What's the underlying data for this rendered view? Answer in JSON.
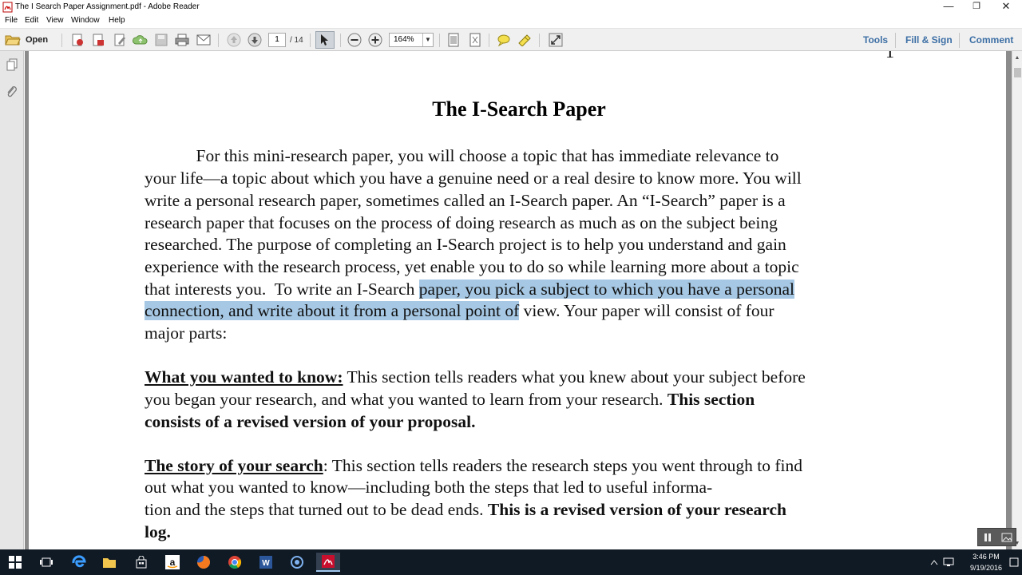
{
  "window": {
    "title": "The I Search Paper Assignment.pdf - Adobe Reader",
    "minimize": "—",
    "restore": "❐",
    "close": "✕"
  },
  "menu": [
    "File",
    "Edit",
    "View",
    "Window",
    "Help"
  ],
  "toolbar": {
    "open_label": "Open",
    "page_current": "1",
    "page_total": "/ 14",
    "zoom": "164%",
    "tools": "Tools",
    "fill_sign": "Fill & Sign",
    "comment": "Comment"
  },
  "document": {
    "page_number": "1",
    "title": "The I-Search Paper",
    "lines": [
      "            For this mini-research paper, you will choose a topic that has immediate relevance to",
      "your life—a topic about which you have a genuine need or a real desire to know more. You will",
      "write a personal research paper, sometimes called an I-Search paper. An “I-Search” paper is a",
      "research paper that focuses on the process of doing research as much as on the subject being",
      "researched. The purpose of completing an I-Search project is to help you understand and gain",
      "experience with the research process, yet enable you to do so while learning more about a topic"
    ],
    "line7_pre": "that interests you.  To write an I-Search ",
    "line7_hl": "paper, you pick a subject to which you have a personal",
    "line8_hl": "connection, and write about it from a personal point of",
    "line8_post": " view. Your paper will consist of four",
    "line9": "major parts:",
    "s1_heading": "What you wanted to know:",
    "s1_l1": " This section tells readers what you knew about your subject before",
    "s1_l2_pre": "you began your research, and what you wanted to learn from your research. ",
    "s1_l2_bold": "This section",
    "s1_l3_bold": "consists of a revised version of your proposal.",
    "s2_heading": "The story of your search",
    "s2_l1": ": This section tells readers the research steps you went through to find",
    "s2_l2": "out what you wanted to know—including both the steps that led to useful informa-",
    "s2_l3_pre": "tion and the steps that turned out to be dead ends. ",
    "s2_l3_bold": "This is a revised version of your research",
    "s2_l4_bold": "log."
  },
  "taskbar": {
    "time": "3:46 PM",
    "date": "9/19/2016"
  },
  "colors": {
    "highlight": "#a6c8e4",
    "pane_link": "#3d6fa5",
    "taskbar": "#101a24"
  }
}
